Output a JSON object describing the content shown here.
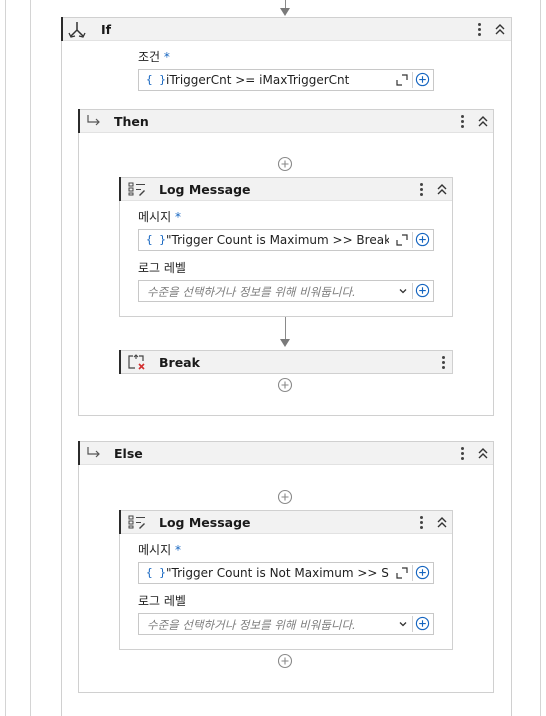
{
  "if_block": {
    "title": "If",
    "condition_label": "조건",
    "required_mark": "*",
    "condition_value": "iTriggerCnt >= iMaxTriggerCnt"
  },
  "then_block": {
    "title": "Then",
    "log_message": {
      "title": "Log Message",
      "message_label": "메시지",
      "required_mark": "*",
      "message_value": "\"Trigger Count is Maximum >> Break Tri",
      "level_label": "로그 레벨",
      "level_placeholder": "수준을 선택하거나 정보를 위해 비워둡니다."
    },
    "break": {
      "title": "Break"
    }
  },
  "else_block": {
    "title": "Else",
    "log_message": {
      "title": "Log Message",
      "message_label": "메시지",
      "required_mark": "*",
      "message_value": "\"Trigger Count is Not Maximum >> Star",
      "level_label": "로그 레벨",
      "level_placeholder": "수준을 선택하거나 정보를 위해 비워둡니다."
    }
  },
  "colors": {
    "accent": "#1565c0",
    "break_x": "#d32f2f",
    "header_bg": "#f2f2f2"
  },
  "icons": [
    "if-icon",
    "then-arrow-icon",
    "else-arrow-icon",
    "log-message-icon",
    "break-icon",
    "more-options-icon",
    "collapse-icon",
    "expand-editor-icon",
    "add-circle-icon",
    "dropdown-chevron-icon"
  ]
}
